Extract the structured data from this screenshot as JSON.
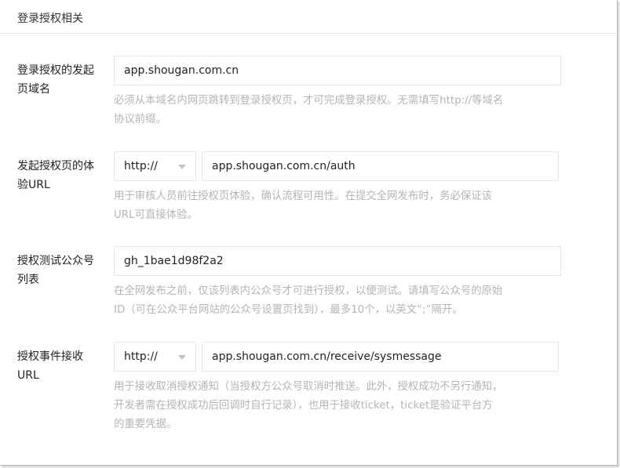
{
  "section": {
    "title": "登录授权相关"
  },
  "fields": [
    {
      "label_line1": "登录授权的发起",
      "label_line2": "页域名",
      "value": "app.shougan.com.cn",
      "hint_line1": "必须从本域名内网页跳转到登录授权页，才可完成登录授权。无需填写http://等域名",
      "hint_line2": "协议前缀。"
    },
    {
      "label_line1": "发起授权页的体",
      "label_line2": "验URL",
      "protocol": "http://",
      "value": "app.shougan.com.cn/auth",
      "hint_line1": "用于审核人员前往授权页体验，确认流程可用性。在提交全网发布时，务必保证该",
      "hint_line2": "URL可直接体验。"
    },
    {
      "label_line1": "授权测试公众号",
      "label_line2": "列表",
      "value": "gh_1bae1d98f2a2",
      "hint_line1": "在全网发布之前，仅该列表内公众号才可进行授权，以便测试。请填写公众号的原始",
      "hint_line2": "ID（可在公众平台网站的公众号设置页找到），最多10个，以英文“;”隔开。"
    },
    {
      "label_line1": "授权事件接收",
      "label_line2": "URL",
      "protocol": "http://",
      "value": "app.shougan.com.cn/receive/sysmessage",
      "hint_line1": "用于接收取消授权通知（当授权方公众号取消时推送。此外，授权成功不另行通知，",
      "hint_line2": "开发者需在授权成功后回调时自行记录），也用于接收ticket，ticket是验证平台方",
      "hint_line3": "的重要凭据。"
    }
  ],
  "colors": {
    "border": "#e7e7eb",
    "hint": "#b4b4b4",
    "text": "#222222"
  }
}
